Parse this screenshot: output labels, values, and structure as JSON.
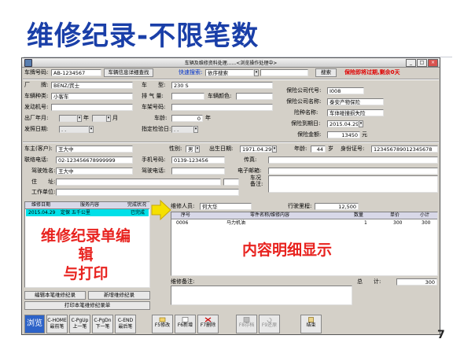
{
  "slide": {
    "title": "维修纪录-不限笔数",
    "page_number": "7"
  },
  "window": {
    "title": "车辆及维修资料处理......<浏览操作处理中>",
    "min_btn": "_",
    "max_btn": "□",
    "close_btn": "×"
  },
  "vehicle": {
    "plate_label": "车牌号码:",
    "plate_value": "AB-1234567",
    "detail_button": "车辆信息详细查找",
    "quick_search_label": "快速搜索:",
    "quick_search_value": "依序搜索",
    "search_button": "搜索",
    "warning": "保险即将过期,剩余0天",
    "brand_label": "厂　　牌:",
    "brand_value": "BENZ/宾士",
    "model_label": "车　　型:",
    "model_value": "230 S",
    "category_label": "车辆种类:",
    "category_value": "小客车",
    "displacement_label": "排 气 量:",
    "color_label": "车辆颜色:",
    "engine_label": "发动机号:",
    "frame_label": "车架号码:",
    "year_label": "出厂年月:",
    "year_unit": "年",
    "month_unit": "月",
    "age_label": "车龄:",
    "age_value": "0",
    "age_unit": "年",
    "issue_label": "发照日期:",
    "issue_value": ". .",
    "inspect_label": "指定检验日:",
    "inspect_value": ". ."
  },
  "insurance": {
    "code_label": "保险公司代号:",
    "code_value": "I008",
    "name_label": "保险公司名称:",
    "name_value": "泰安产物保险",
    "type_label": "险种名称:",
    "type_value": "车体碰撞损失险",
    "expire_label": "保险到期日:",
    "expire_value": "2015.04.29",
    "amount_label": "保险金额:",
    "amount_value": "13450",
    "amount_unit": "元"
  },
  "owner": {
    "owner_label": "车主(客户):",
    "owner_value": "王大中",
    "gender_label": "性别:",
    "gender_value": "男",
    "birth_label": "出生日期:",
    "birth_value": "1971.04.29",
    "age_label": "年龄:",
    "age_value": "44",
    "age_unit": "岁",
    "id_label": "身份证号:",
    "id_value": "123456789012345678",
    "phone_label": "联络电话:",
    "phone_value": "02-123456678999999",
    "mobile_label": "手机号码:",
    "mobile_value": "0139-123456",
    "fax_label": "传真:",
    "driver_label": "驾驶姓名:",
    "driver_value": "王大中",
    "driver_phone_label": "驾驶电话:",
    "email_label": "电子邮箱:",
    "address_label": "住　　址:",
    "notes_label": "车况\n备注:",
    "work_label": "工作单位:"
  },
  "history": {
    "columns": [
      "维修日期",
      "服务内容",
      "完成状况"
    ],
    "rows": [
      [
        "2015.04.29",
        "定保 五千公里",
        "已完成"
      ]
    ],
    "edit_button": "编辑本笔维修纪录",
    "add_button": "新增维修纪录",
    "print_button": "打印本笔维修纪录单"
  },
  "detail": {
    "staff_label": "维修人员:",
    "staff_value": "何大华",
    "mileage_label": "行驶里程:",
    "mileage_value": "12,500",
    "columns": [
      "序号",
      "零件名称/维修内容",
      "数量",
      "单价",
      "小计"
    ],
    "rows": [
      [
        "0006",
        "马力机油",
        "1",
        "300",
        "300"
      ]
    ],
    "remark_label": "维修备注:",
    "total_label": "总　　计:",
    "total_value": "300"
  },
  "overlays": {
    "left": "维修纪录单编辑\n与打印",
    "right": "内容明细显示"
  },
  "toolbar": [
    {
      "name": "browse",
      "line1": "浏览",
      "line2": ""
    },
    {
      "name": "first",
      "line1": "C-HOME",
      "line2": "最前笔"
    },
    {
      "name": "prev",
      "line1": "C-PgUp",
      "line2": "上一笔"
    },
    {
      "name": "next",
      "line1": "C-PgDn",
      "line2": "下一笔"
    },
    {
      "name": "last",
      "line1": "C-END",
      "line2": "最后笔"
    },
    {
      "name": "f5",
      "line1": "",
      "line2": "F5修改"
    },
    {
      "name": "f6",
      "line1": "",
      "line2": "F6新增"
    },
    {
      "name": "f7",
      "line1": "",
      "line2": "F7删除"
    },
    {
      "name": "f8",
      "line1": "",
      "line2": "F8存档"
    },
    {
      "name": "f9",
      "line1": "",
      "line2": "F9还原"
    },
    {
      "name": "exit",
      "line1": "",
      "line2": "结束"
    }
  ]
}
